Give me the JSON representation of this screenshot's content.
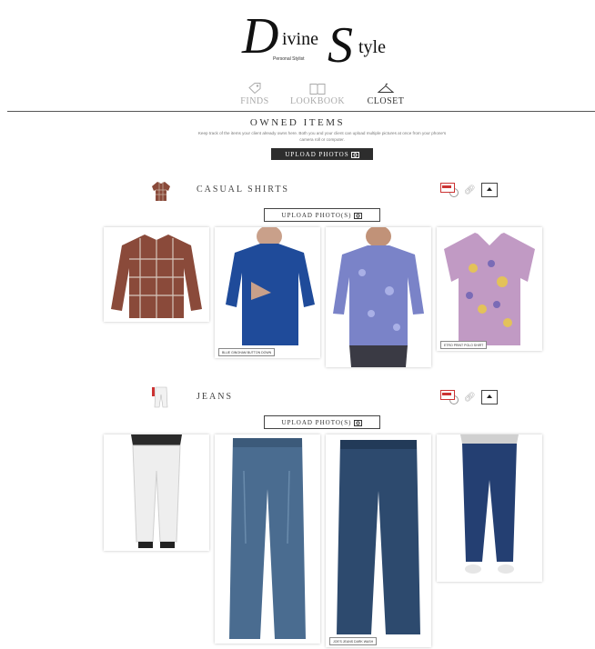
{
  "logo": {
    "brand_part1": "ivine",
    "brand_part2": "tyle",
    "initial1": "D",
    "initial2": "S",
    "tagline": "Personal Stylist"
  },
  "nav": {
    "items": [
      {
        "label": "FINDS"
      },
      {
        "label": "LOOKBOOK"
      },
      {
        "label": "CLOSET"
      }
    ],
    "active": "CLOSET"
  },
  "owned": {
    "title": "OWNED ITEMS",
    "description": "Keep track of the items your client already owns here. Both you and your client can upload multiple pictures at once from your phone's camera roll or computer.",
    "upload_label": "UPLOAD PHOTOS"
  },
  "sections": [
    {
      "title": "CASUAL SHIRTS",
      "upload_label": "UPLOAD PHOTO(S)",
      "items": [
        {
          "caption": "",
          "color": "#8a4a3a"
        },
        {
          "caption": "BLUE GINGHAM BUTTON DOWN",
          "color": "#1f4b9a"
        },
        {
          "caption": "",
          "color": "#7a83c8"
        },
        {
          "caption": "ETRO PRINT POLO SHIRT",
          "color": "#c19ac4"
        }
      ]
    },
    {
      "title": "JEANS",
      "upload_label": "UPLOAD PHOTO(S)",
      "items": [
        {
          "caption": "",
          "color": "#f0f0f0"
        },
        {
          "caption": "",
          "color": "#4a6c90"
        },
        {
          "caption": "JOE'S JEANS DARK WASH",
          "color": "#2d4a6e"
        },
        {
          "caption": "",
          "color": "#243f72"
        }
      ]
    }
  ],
  "colors": {
    "dark_button": "#2d2d2d",
    "accent_red": "#cc3333"
  }
}
